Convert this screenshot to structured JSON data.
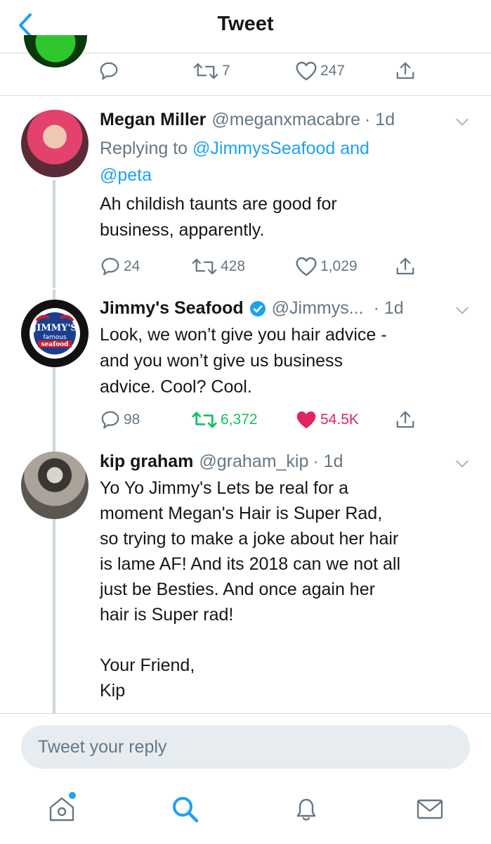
{
  "header": {
    "title": "Tweet",
    "back_icon": "chevron-left-icon"
  },
  "prev_tweet": {
    "actions": {
      "replies": "",
      "retweets": "7",
      "likes": "247"
    }
  },
  "tweets": [
    {
      "name": "Megan Miller",
      "handle": "@meganxmacabre",
      "time": "· 1d",
      "reply_prefix": "Replying to ",
      "reply_to_1": "@JimmysSeafood",
      "reply_and": " and",
      "reply_to_2": "@peta",
      "text": "Ah childish taunts are good for\nbusiness, apparently.",
      "replies": "24",
      "retweets": "428",
      "likes": "1,029"
    },
    {
      "name": "Jimmy's Seafood",
      "handle": "@Jimmys...",
      "time": "· 1d",
      "verified": true,
      "avatar_text_1": "JIMMY'S",
      "avatar_text_2": "famous",
      "avatar_text_3": "seafood",
      "text": "Look, we won’t give you hair advice -\nand you won’t give us business\nadvice. Cool? Cool.",
      "replies": "98",
      "retweets": "6,372",
      "likes": "54.5K"
    },
    {
      "name": "kip graham",
      "handle": "@graham_kip",
      "time": "· 1d",
      "text": "Yo Yo Jimmy's Lets be real for a\nmoment Megan's Hair is Super Rad,\nso trying to make a joke about her hair\nis lame AF! And its 2018 can we not all\njust be Besties. And once again her\nhair is Super rad!\n\nYour Friend,\nKip"
    }
  ],
  "reply_bar": {
    "placeholder": "Tweet your reply"
  },
  "tabbar": {
    "items": [
      "home-icon",
      "search-icon",
      "notifications-icon",
      "messages-icon"
    ]
  },
  "colors": {
    "accent": "#1da1f2",
    "retweet_active": "#17bf63",
    "like_active": "#e0245e",
    "secondary_text": "#657786"
  }
}
